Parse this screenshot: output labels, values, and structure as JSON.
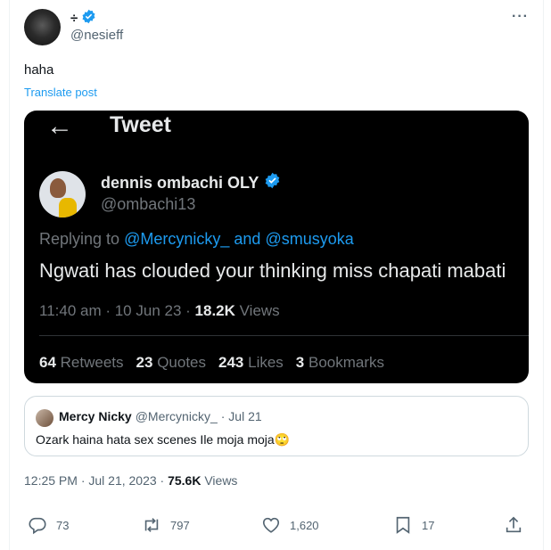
{
  "author": {
    "name": "÷",
    "handle": "@nesieff"
  },
  "more_label": "···",
  "post": {
    "text": "haha",
    "translate_label": "Translate post"
  },
  "screenshot": {
    "back_glyph": "←",
    "header": "Tweet",
    "author_name": "dennis ombachi OLY",
    "author_handle": "@ombachi13",
    "reply_prefix": "Replying to",
    "reply_user1": "@Mercynicky_",
    "reply_and": "and",
    "reply_user2": "@smusyoka",
    "body": "Ngwati has clouded your thinking miss chapati mabati",
    "time": "11:40 am · 10 Jun 23 ·",
    "views_count": "18.2K",
    "views_label": "Views",
    "stats": [
      {
        "count": "64",
        "label": "Retweets"
      },
      {
        "count": "23",
        "label": "Quotes"
      },
      {
        "count": "243",
        "label": "Likes"
      },
      {
        "count": "3",
        "label": "Bookmarks"
      }
    ]
  },
  "quote": {
    "name": "Mercy Nicky",
    "handle": "@Mercynicky_",
    "date": "· Jul 21",
    "text": "Ozark haina hata sex scenes Ile moja moja🙄"
  },
  "meta": {
    "time": "12:25 PM · Jul 21, 2023 ·",
    "views_count": "75.6K",
    "views_label": "Views"
  },
  "actions": {
    "replies": "73",
    "reposts": "797",
    "likes": "1,620",
    "bookmarks": "17"
  },
  "colors": {
    "accent": "#1d9bf0",
    "text": "#0f1419",
    "secondary": "#536471",
    "dark_bg": "#000000"
  }
}
